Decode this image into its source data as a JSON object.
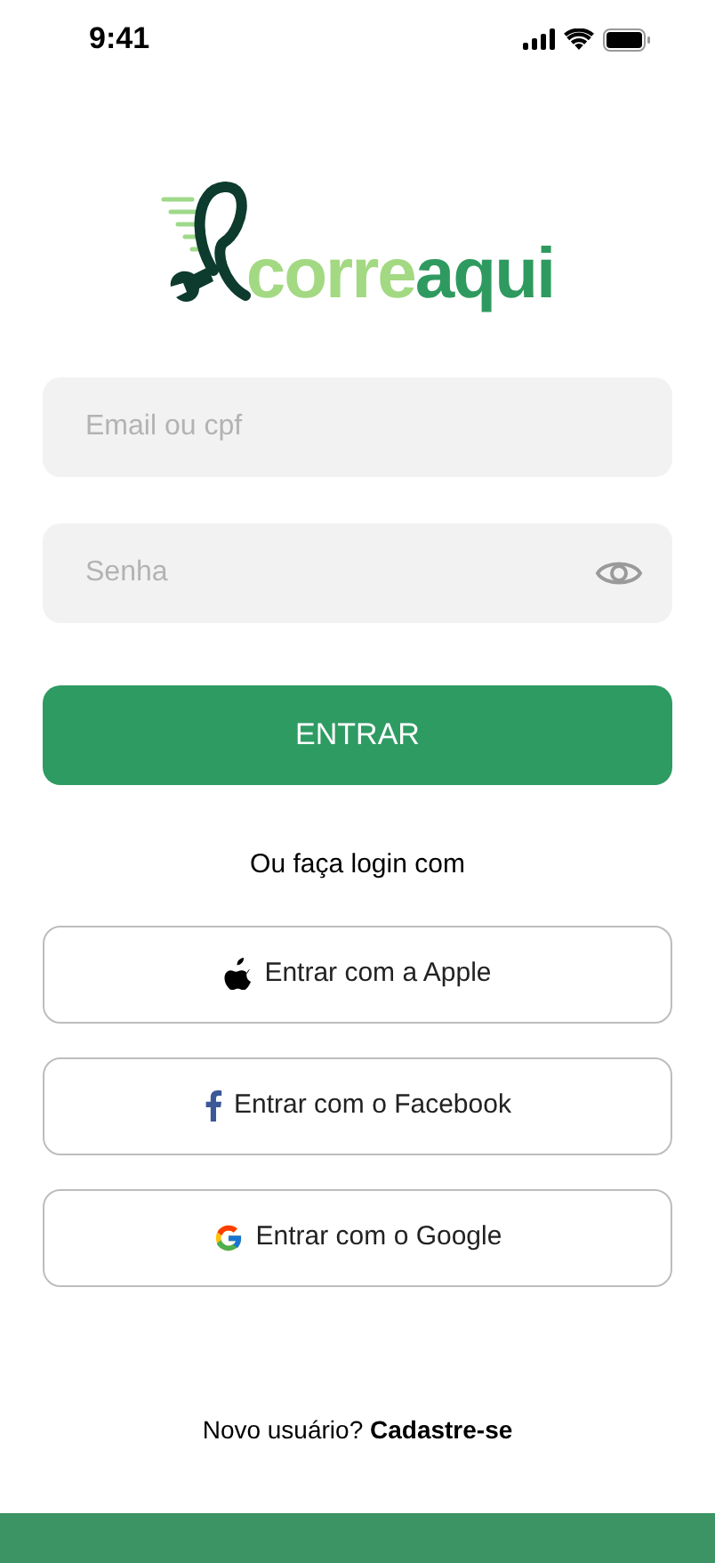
{
  "status_bar": {
    "time": "9:41"
  },
  "logo": {
    "part_1": "corre",
    "part_2": "aqui"
  },
  "fields": [
    {
      "kind": "text",
      "placeholder": "Email ou cpf"
    },
    {
      "kind": "password",
      "placeholder": "Senha"
    }
  ],
  "submit_button": "ENTRAR",
  "divider_text": "Ou faça login com",
  "social_buttons": [
    {
      "kind": "apple",
      "label": "Entrar com a Apple"
    },
    {
      "kind": "facebook",
      "label": "Entrar com o Facebook"
    },
    {
      "kind": "google",
      "label": "Entrar com o Google"
    }
  ],
  "signup": {
    "text": "Novo usuário?",
    "link": "Cadastre-se"
  }
}
